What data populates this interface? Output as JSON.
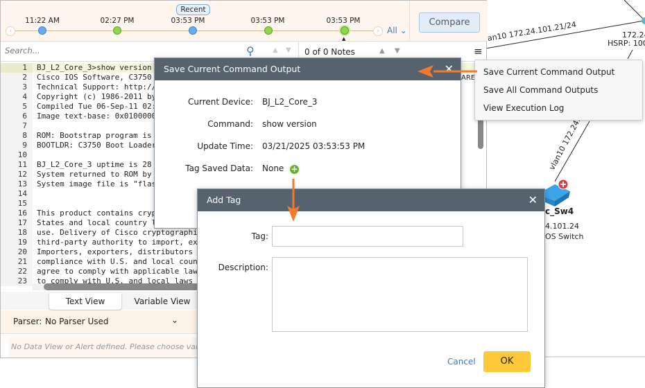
{
  "timeline": {
    "recent_label": "Recent",
    "points": [
      {
        "time": "11:22 AM",
        "color": "blue"
      },
      {
        "time": "02:27 PM",
        "color": "green"
      },
      {
        "time": "03:53 PM",
        "color": "blue"
      },
      {
        "time": "03:53 PM",
        "color": "green"
      },
      {
        "time": "03:53 PM",
        "color": "green",
        "selected": true
      }
    ],
    "filter": "All"
  },
  "compare_label": "Compare",
  "search": {
    "placeholder": "Search..."
  },
  "notes": {
    "count": "0 of 0 Notes"
  },
  "code_lines": [
    "BJ_L2_Core_3>show version",
    "Cisco IOS Software, C3750",
    "Technical Support: http://",
    "Copyright (c) 1986-2011 by",
    "Compiled Tue 06-Sep-11 02:",
    "Image text-base: 0x0100000",
    "",
    "ROM: Bootstrap program is",
    "BOOTLDR: C3750 Boot Loader",
    "",
    "BJ_L2_Core_3 uptime is 28",
    "System returned to ROM by",
    "System image file is \"flas",
    "",
    "",
    "This product contains cryp",
    "States and local country l",
    "use. Delivery of Cisco cryptographi",
    "third-party authority to import, ex",
    "Importers, exporters, distributors",
    "compliance with U.S. and local coun",
    "agree to comply with applicable law",
    "to comply with U.S. and local laws",
    ""
  ],
  "notes_partial": "ARE",
  "tabs": [
    "Text View",
    "Variable View"
  ],
  "parser": {
    "label": "Parser:",
    "value": "No Parser Used"
  },
  "message": "No Data View or Alert defined. Please choose variab",
  "menu": [
    "Save Current Command Output",
    "Save All Command Outputs",
    "View Execution Log"
  ],
  "save_dialog": {
    "title": "Save Current Command Output",
    "fields": [
      {
        "label": "Current Device:",
        "value": "BJ_L2_Core_3"
      },
      {
        "label": "Command:",
        "value": "show version"
      },
      {
        "label": "Update Time:",
        "value": "03/21/2025 03:53:53 PM"
      },
      {
        "label": "Tag Saved Data:",
        "value": "None"
      }
    ]
  },
  "add_tag": {
    "title": "Add Tag",
    "tag_label": "Tag:",
    "tag_value": "",
    "desc_label": "Description:",
    "desc_value": "",
    "cancel": "Cancel",
    "ok": "OK"
  },
  "map": {
    "link1": "an10 172.24.101.21/24",
    "node_ip": "172.24",
    "hsrp": "HSRP: 100(",
    "link2": "vlan10 172.24.",
    "device_name": "c_Sw4",
    "device_ip": "4.101.24",
    "device_type": "OS Switch"
  },
  "colors": {
    "accent": "#f47a2a",
    "header": "#56636e",
    "ok": "#fdc83a"
  }
}
